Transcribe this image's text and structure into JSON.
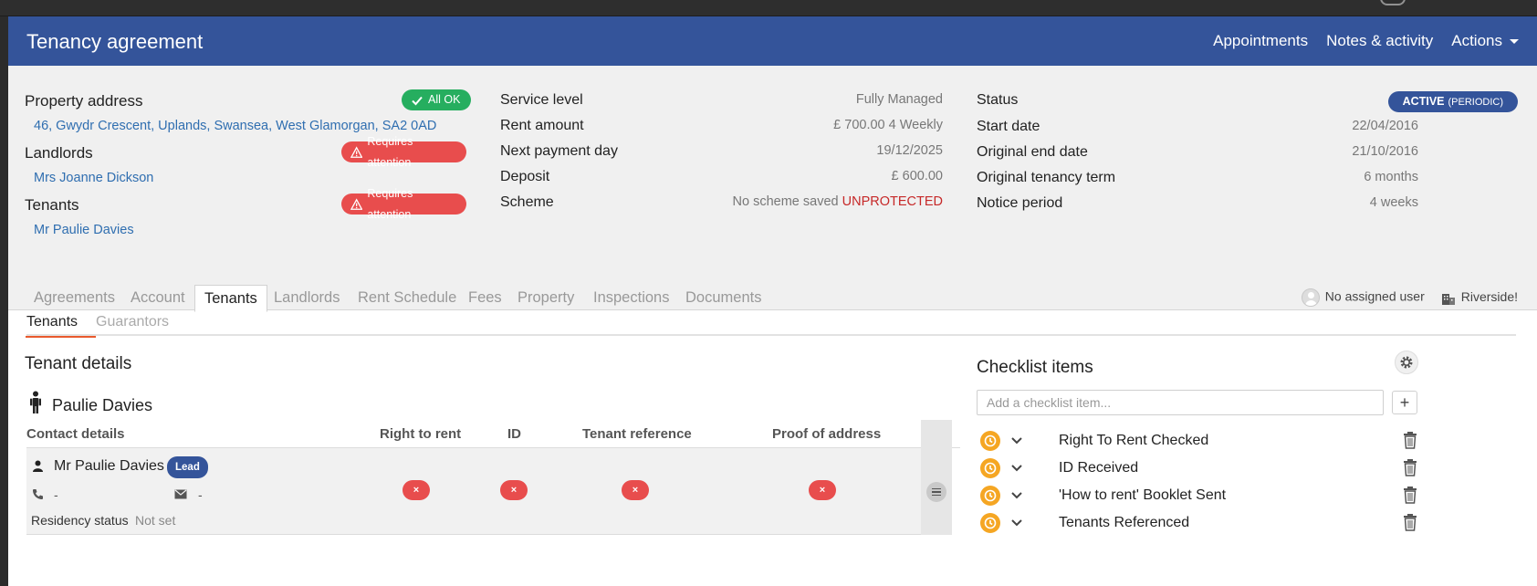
{
  "header": {
    "title": "Tenancy agreement",
    "nav": [
      "Appointments",
      "Notes & activity",
      "Actions"
    ]
  },
  "summary": {
    "property_address_label": "Property address",
    "property_address_badge": "All OK",
    "property_address": "46, Gwydr Crescent, Uplands, Swansea, West Glamorgan, SA2 0AD",
    "landlords_label": "Landlords",
    "landlords_badge": "Requires attention",
    "landlord_name": "Mrs Joanne Dickson",
    "tenants_label": "Tenants",
    "tenants_badge": "Requires attention",
    "tenant_name": "Mr Paulie Davies",
    "middle": [
      {
        "label": "Service level",
        "value": "Fully Managed"
      },
      {
        "label": "Rent amount",
        "value": "£ 700.00 4 Weekly"
      },
      {
        "label": "Next payment day",
        "value": "19/12/2025"
      },
      {
        "label": "Deposit",
        "value": "£ 600.00"
      },
      {
        "label": "Scheme",
        "value": "No scheme saved",
        "flag": "UNPROTECTED"
      }
    ],
    "status_label": "Status",
    "status_value": "ACTIVE",
    "status_sub": "(PERIODIC)",
    "right": [
      {
        "label": "Start date",
        "value": "22/04/2016"
      },
      {
        "label": "Original end date",
        "value": "21/10/2016"
      },
      {
        "label": "Original tenancy term",
        "value": "6 months"
      },
      {
        "label": "Notice period",
        "value": "4 weeks"
      }
    ]
  },
  "tabs": [
    "Agreements",
    "Account",
    "Tenants",
    "Landlords",
    "Rent Schedule",
    "Fees",
    "Property",
    "Inspections",
    "Documents"
  ],
  "active_tab": "Tenants",
  "assigned_user": "No assigned user",
  "branch": "Riverside!",
  "subtabs": [
    "Tenants",
    "Guarantors"
  ],
  "tenant_details": {
    "title": "Tenant details",
    "person": "Paulie Davies",
    "columns": [
      "Contact details",
      "Right to rent",
      "ID",
      "Tenant reference",
      "Proof of address"
    ],
    "row": {
      "name": "Mr Paulie Davies",
      "tag": "Lead",
      "phone": "-",
      "email": "-",
      "residency_label": "Residency status",
      "residency_value": "Not set",
      "status_marks": [
        "×",
        "×",
        "×",
        "×"
      ]
    }
  },
  "checklist": {
    "title": "Checklist items",
    "input_placeholder": "Add a checklist item...",
    "add_label": "+",
    "items": [
      "Right To Rent Checked",
      "ID Received",
      "'How to rent' Booklet Sent",
      "Tenants Referenced"
    ]
  },
  "colors": {
    "brand": "#34549a",
    "ok": "#26ae5f",
    "warn": "#e84d4d",
    "pending": "#f5a623",
    "accent": "#e9592d"
  }
}
